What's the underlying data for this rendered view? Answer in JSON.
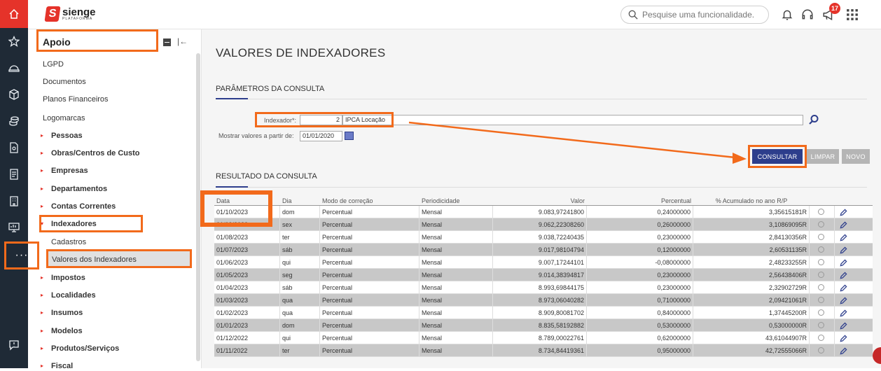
{
  "app": {
    "brand": "sienge",
    "brand_sub": "PLATAFORMA"
  },
  "header": {
    "search_placeholder": "Pesquise uma funcionalidade.",
    "notif_count": "17"
  },
  "sidebar": {
    "title": "Apoio",
    "items": [
      {
        "label": "LGPD",
        "type": "link"
      },
      {
        "label": "Documentos",
        "type": "link"
      },
      {
        "label": "Planos Financeiros",
        "type": "link"
      },
      {
        "label": "Logomarcas",
        "type": "link"
      },
      {
        "label": "Pessoas",
        "type": "group"
      },
      {
        "label": "Obras/Centros de Custo",
        "type": "group"
      },
      {
        "label": "Empresas",
        "type": "group"
      },
      {
        "label": "Departamentos",
        "type": "group"
      },
      {
        "label": "Contas Correntes",
        "type": "group"
      },
      {
        "label": "Indexadores",
        "type": "group-open"
      },
      {
        "label": "Cadastros",
        "type": "sub"
      },
      {
        "label": "Valores dos Indexadores",
        "type": "sub-active"
      },
      {
        "label": "Impostos",
        "type": "group"
      },
      {
        "label": "Localidades",
        "type": "group"
      },
      {
        "label": "Insumos",
        "type": "group"
      },
      {
        "label": "Modelos",
        "type": "group"
      },
      {
        "label": "Produtos/Serviços",
        "type": "group"
      },
      {
        "label": "Fiscal",
        "type": "group"
      }
    ]
  },
  "page": {
    "title": "VALORES DE INDEXADORES",
    "params_title": "PARÂMETROS DA CONSULTA",
    "result_title": "RESULTADO DA CONSULTA",
    "indexador_label": "Indexador*:",
    "indexador_code": "2",
    "indexador_name": "IPCA Locação",
    "date_label": "Mostrar valores a partir de:",
    "date_value": "01/01/2020",
    "btn_consultar": "CONSULTAR",
    "btn_limpar": "LIMPAR",
    "btn_novo": "NOVO"
  },
  "table": {
    "headers": [
      "Data",
      "Dia",
      "Modo de correção",
      "Periodicidade",
      "Valor",
      "Percentual",
      "% Acumulado no ano R/P"
    ],
    "rows": [
      [
        "01/10/2023",
        "dom",
        "Percentual",
        "Mensal",
        "9.083,97241800",
        "0,24000000",
        "3,35615181R"
      ],
      [
        "01/09/2023",
        "sex",
        "Percentual",
        "Mensal",
        "9.062,22308260",
        "0,26000000",
        "3,10869095R"
      ],
      [
        "01/08/2023",
        "ter",
        "Percentual",
        "Mensal",
        "9.038,72240435",
        "0,23000000",
        "2,84130356R"
      ],
      [
        "01/07/2023",
        "sáb",
        "Percentual",
        "Mensal",
        "9.017,98104794",
        "0,12000000",
        "2,60531135R"
      ],
      [
        "01/06/2023",
        "qui",
        "Percentual",
        "Mensal",
        "9.007,17244101",
        "-0,08000000",
        "2,48233255R"
      ],
      [
        "01/05/2023",
        "seg",
        "Percentual",
        "Mensal",
        "9.014,38394817",
        "0,23000000",
        "2,56438406R"
      ],
      [
        "01/04/2023",
        "sáb",
        "Percentual",
        "Mensal",
        "8.993,69844175",
        "0,23000000",
        "2,32902729R"
      ],
      [
        "01/03/2023",
        "qua",
        "Percentual",
        "Mensal",
        "8.973,06040282",
        "0,71000000",
        "2,09421061R"
      ],
      [
        "01/02/2023",
        "qua",
        "Percentual",
        "Mensal",
        "8.909,80081702",
        "0,84000000",
        "1,37445200R"
      ],
      [
        "01/01/2023",
        "dom",
        "Percentual",
        "Mensal",
        "8.835,58192882",
        "0,53000000",
        "0,53000000R"
      ],
      [
        "01/12/2022",
        "qui",
        "Percentual",
        "Mensal",
        "8.789,00022761",
        "0,62000000",
        "43,61044907R"
      ],
      [
        "01/11/2022",
        "ter",
        "Percentual",
        "Mensal",
        "8.734,84419361",
        "0,95000000",
        "42,72555066R"
      ]
    ]
  }
}
